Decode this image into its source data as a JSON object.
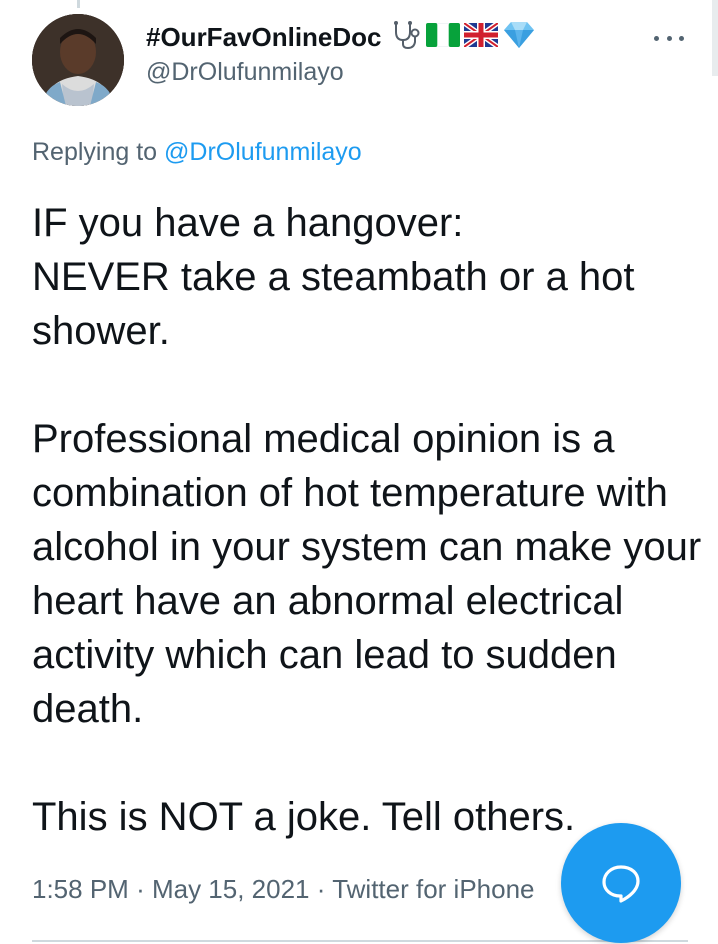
{
  "author": {
    "display_name": "#OurFavOnlineDoc",
    "handle": "@DrOlufunmilayo",
    "name_icons": [
      "stethoscope-icon",
      "nigeria-flag-icon",
      "uk-flag-icon",
      "blue-diamond-icon"
    ]
  },
  "reply": {
    "prefix": "Replying to",
    "mention": "@DrOlufunmilayo"
  },
  "tweet": {
    "text": "IF you have a hangover:\nNEVER take a steambath or a hot shower.\n\nProfessional medical opinion is a combination of hot temperature with alcohol in your system can make your heart have an abnormal electrical activity which can lead to sudden death.\n\nThis is NOT a joke. Tell others.",
    "time": "1:58 PM",
    "date": "May 15, 2021",
    "source": "Twitter for iPhone",
    "separator": "·"
  },
  "fab": {
    "icon": "compose-reply-icon"
  },
  "colors": {
    "accent": "#1d9bf0",
    "text_primary": "#0f1419",
    "text_secondary": "#536471",
    "divider": "#cfd9de"
  }
}
